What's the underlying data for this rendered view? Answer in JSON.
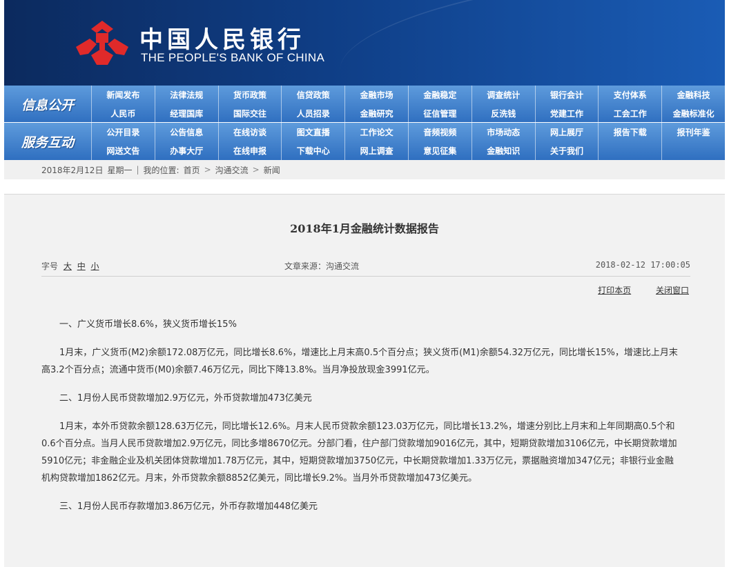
{
  "header": {
    "cn_title": "中国人民银行",
    "en_title": "THE PEOPLE'S BANK OF CHINA",
    "logo_color": "#e02a2a"
  },
  "nav": {
    "info": {
      "section_label": "信息公开",
      "row1": [
        "新闻发布",
        "法律法规",
        "货币政策",
        "信贷政策",
        "金融市场",
        "金融稳定",
        "调查统计",
        "银行会计",
        "支付体系",
        "金融科技"
      ],
      "row2": [
        "人民币",
        "经理国库",
        "国际交往",
        "人员招录",
        "金融研究",
        "征信管理",
        "反洗钱",
        "党建工作",
        "工会工作",
        "金融标准化"
      ]
    },
    "service": {
      "section_label": "服务互动",
      "row1": [
        "公开目录",
        "公告信息",
        "在线访谈",
        "图文直播",
        "工作论文",
        "音频视频",
        "市场动态",
        "网上展厅",
        "报告下载",
        "报刊年鉴"
      ],
      "row2": [
        "网送文告",
        "办事大厅",
        "在线申报",
        "下载中心",
        "网上调查",
        "意见征集",
        "金融知识",
        "关于我们",
        "",
        ""
      ]
    }
  },
  "breadcrumb": {
    "date": "2018年2月12日",
    "weekday": "星期一",
    "location_label": "我的位置:",
    "items": [
      "首页",
      "沟通交流",
      "新闻"
    ],
    "separator": ">",
    "divider": "|"
  },
  "article": {
    "title": "2018年1月金融统计数据报告",
    "font_size_label": "字号",
    "font_sizes": [
      "大",
      "中",
      "小"
    ],
    "source": "文章来源：沟通交流",
    "datetime": "2018-02-12 17:00:05",
    "print_label": "打印本页",
    "close_label": "关闭窗口",
    "sections": [
      {
        "heading": "一、广义货币增长8.6%，狭义货币增长15%",
        "body": "1月末，广义货币(M2)余额172.08万亿元，同比增长8.6%，增速比上月末高0.5个百分点；狭义货币(M1)余额54.32万亿元，同比增长15%，增速比上月末高3.2个百分点；流通中货币(M0)余额7.46万亿元，同比下降13.8%。当月净投放现金3991亿元。"
      },
      {
        "heading": "二、1月份人民币贷款增加2.9万亿元，外币贷款增加473亿美元",
        "body": "1月末，本外币贷款余额128.63万亿元，同比增长12.6%。月末人民币贷款余额123.03万亿元，同比增长13.2%，增速分别比上月末和上年同期高0.5个和0.6个百分点。当月人民币贷款增加2.9万亿元，同比多增8670亿元。分部门看，住户部门贷款增加9016亿元，其中，短期贷款增加3106亿元，中长期贷款增加5910亿元；非金融企业及机关团体贷款增加1.78万亿元，其中，短期贷款增加3750亿元，中长期贷款增加1.33万亿元，票据融资增加347亿元；非银行业金融机构贷款增加1862亿元。月末，外币贷款余额8852亿美元，同比增长9.2%。当月外币贷款增加473亿美元。"
      },
      {
        "heading": "三、1月份人民币存款增加3.86万亿元，外币存款增加448亿美元",
        "body": ""
      }
    ]
  }
}
